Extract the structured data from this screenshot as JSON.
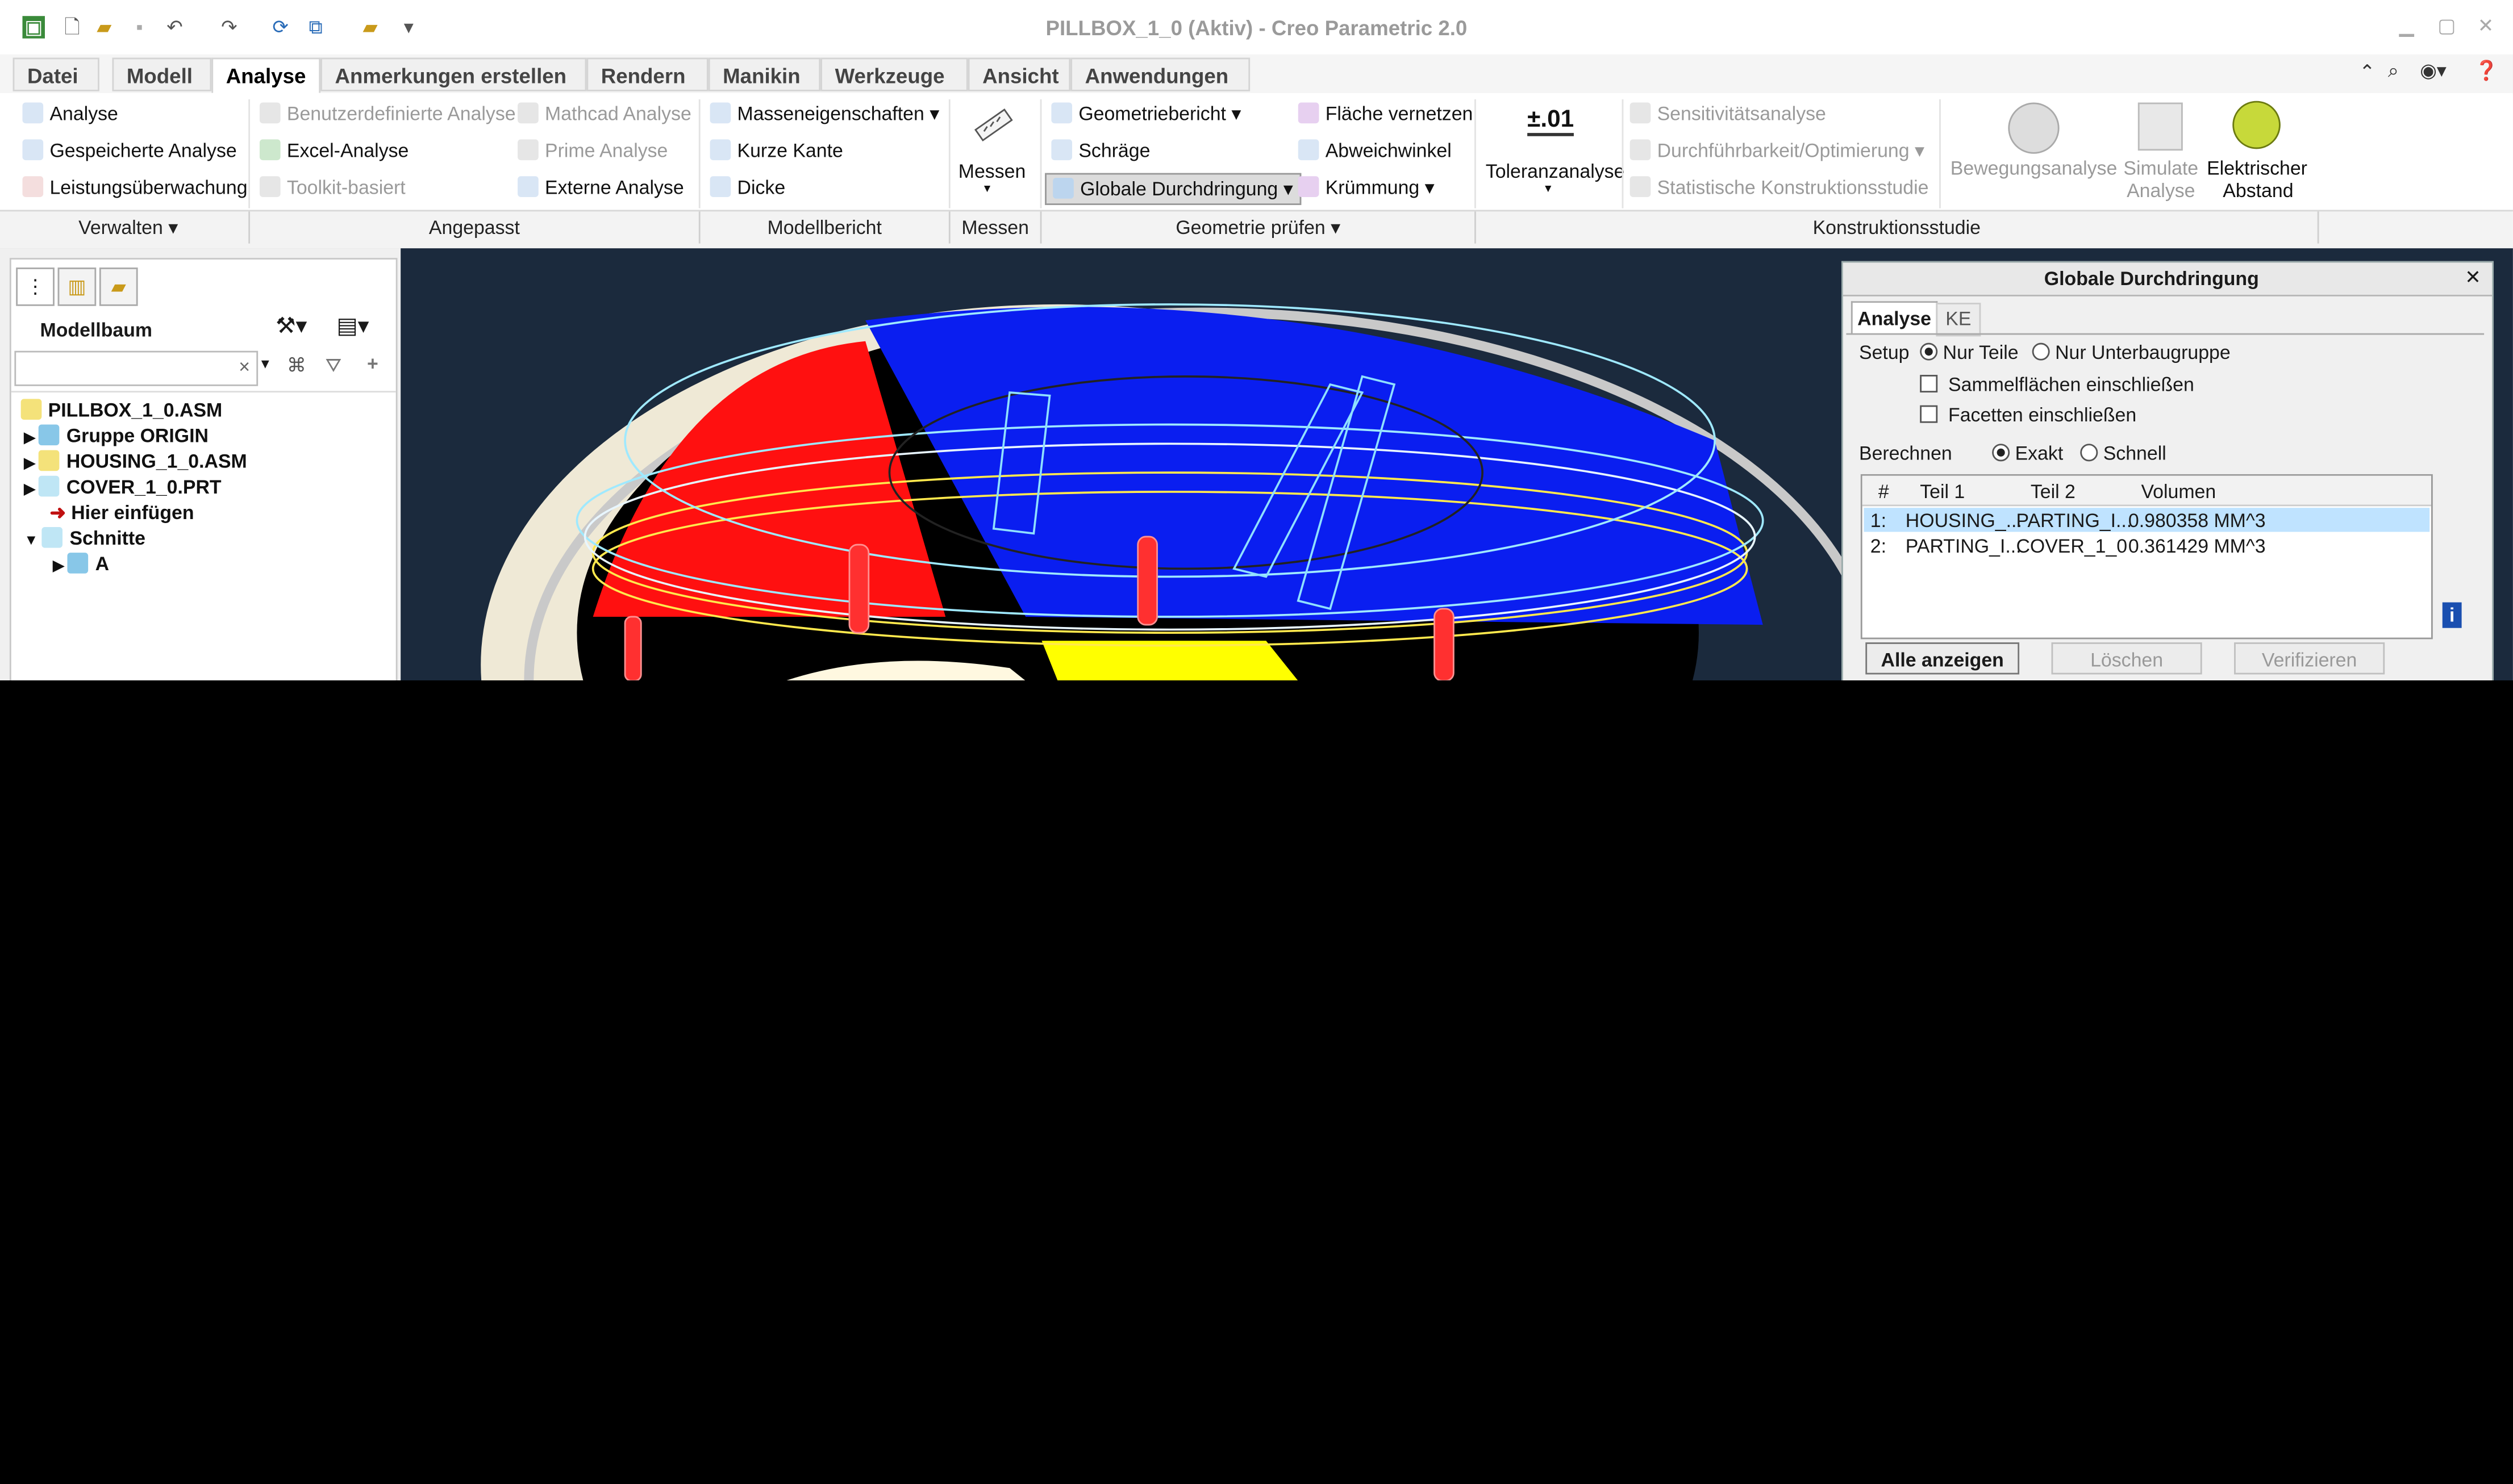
{
  "window": {
    "title": "PILLBOX_1_0 (Aktiv) - Creo Parametric 2.0"
  },
  "tabs": [
    {
      "label": "Datei"
    },
    {
      "label": "Modell"
    },
    {
      "label": "Analyse"
    },
    {
      "label": "Anmerkungen erstellen"
    },
    {
      "label": "Rendern"
    },
    {
      "label": "Manikin"
    },
    {
      "label": "Werkzeuge"
    },
    {
      "label": "Ansicht"
    },
    {
      "label": "Anwendungen"
    }
  ],
  "active_tab": "Analyse",
  "ribbon": {
    "verwalten": {
      "analyse": "Analyse",
      "gespeicherte": "Gespeicherte Analyse",
      "leistung": "Leistungsüberwachung"
    },
    "angepasst": {
      "benutzer": "Benutzerdefinierte Analyse",
      "excel": "Excel-Analyse",
      "toolkit": "Toolkit-basiert",
      "mathcad": "Mathcad Analyse",
      "prime": "Prime Analyse",
      "extern": "Externe Analyse"
    },
    "modellbericht": {
      "masse": "Masseneigenschaften",
      "kurze": "Kurze Kante",
      "dicke": "Dicke"
    },
    "messen": {
      "label": "Messen"
    },
    "geometrie": {
      "bericht": "Geometriebericht",
      "schraege": "Schräge",
      "globale": "Globale Durchdringung",
      "flaeche": "Fläche vernetzen",
      "abweich": "Abweichwinkel",
      "kruemmung": "Krümmung"
    },
    "toleranz": {
      "icon_text": "±.01",
      "label": "Toleranzanalyse"
    },
    "konstruktion": {
      "sens": "Sensitivitätsanalyse",
      "durch": "Durchführbarkeit/Optimierung",
      "stat": "Statistische Konstruktionsstudie",
      "bewegung": "Bewegungsanalyse",
      "simulate1": "Simulate",
      "simulate2": "Analyse",
      "elek1": "Elektrischer",
      "elek2": "Abstand"
    },
    "groups": [
      "Verwalten",
      "Angepasst",
      "Modellbericht",
      "Messen",
      "Geometrie prüfen",
      "Konstruktionsstudie"
    ]
  },
  "model_tree": {
    "title": "Modellbaum",
    "search_value": "",
    "items": [
      {
        "label": "PILLBOX_1_0.ASM"
      },
      {
        "label": "Gruppe ORIGIN"
      },
      {
        "label": "HOUSING_1_0.ASM"
      },
      {
        "label": "COVER_1_0.PRT"
      },
      {
        "label": "Hier einfügen"
      },
      {
        "label": "Schnitte"
      },
      {
        "label": "A"
      }
    ]
  },
  "dialog": {
    "title": "Globale Durchdringung",
    "tabs": [
      "Analyse",
      "KE"
    ],
    "setup_label": "Setup",
    "nur_teile": "Nur Teile",
    "nur_unter": "Nur Unterbaugruppe",
    "sammel": "Sammelflächen einschließen",
    "facetten": "Facetten einschließen",
    "berechnen_label": "Berechnen",
    "exakt": "Exakt",
    "schnell": "Schnell",
    "columns": [
      "#",
      "Teil 1",
      "Teil 2",
      "Volumen"
    ],
    "rows": [
      {
        "num": "1:",
        "teil1": "HOUSING_...",
        "teil2": "PARTING_I...",
        "vol": "0.980358 MM^3"
      },
      {
        "num": "2:",
        "teil1": "PARTING_I...",
        "teil2": "COVER_1_0",
        "vol": "0.361429 MM^3"
      }
    ],
    "btn_show": "Alle anzeigen",
    "btn_delete": "Löschen",
    "btn_verify": "Verifizieren"
  },
  "colors": {
    "accent": "#1a6fc4",
    "viewport_bg": "#1b2a3d",
    "selection_row": "#bfe3ff"
  }
}
